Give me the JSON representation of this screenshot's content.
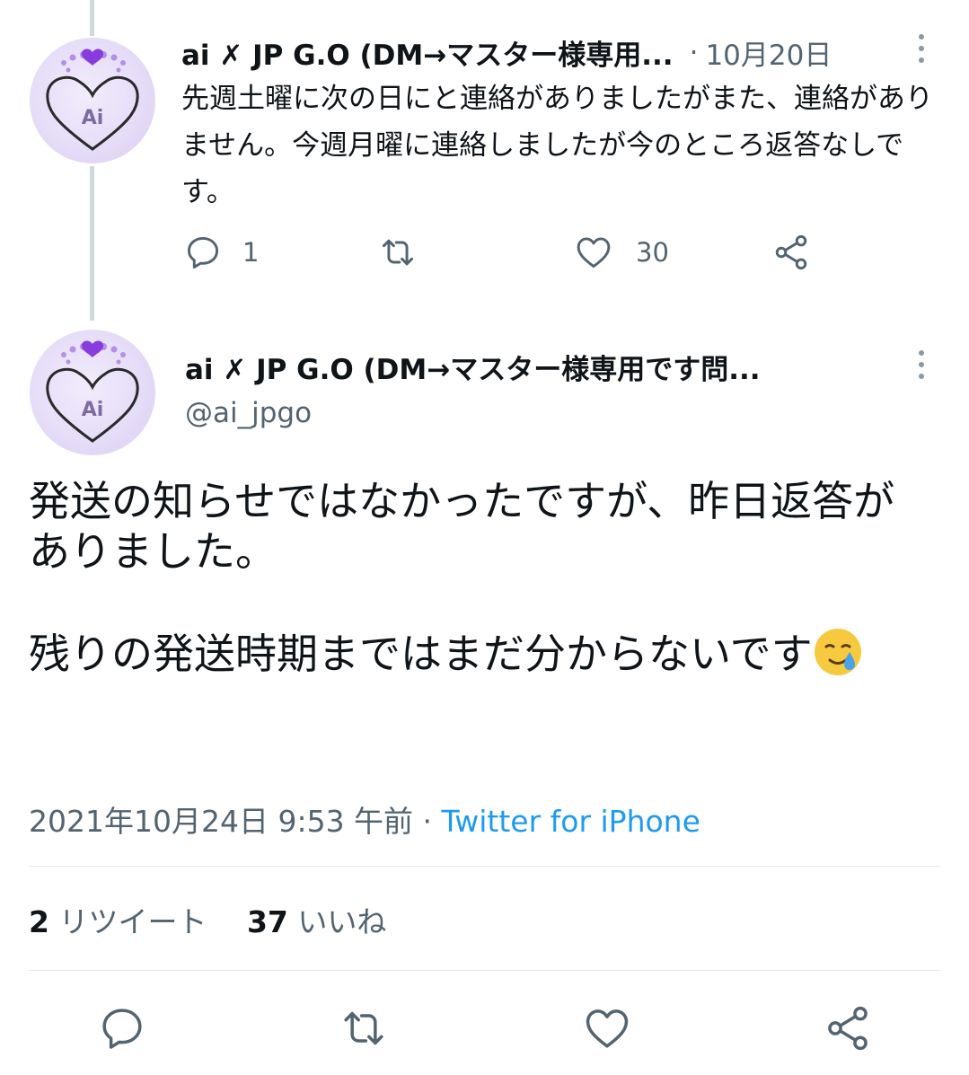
{
  "reply_tweet": {
    "display_name": "ai ✗ JP G.O (DM→マスター様専用...",
    "separator": "·",
    "date": "10月20日",
    "text": "先週土曜に次の日にと連絡がありましたがまた、連絡がありません。今週月曜に連絡しましたが今のところ返答なしです。",
    "reply_count": "1",
    "like_count": "30",
    "avatar_label": "Ai"
  },
  "main_tweet": {
    "display_name": "ai ✗ JP G.O (DM→マスター様専用です問...",
    "handle": "@ai_jpgo",
    "avatar_label": "Ai",
    "text_line1": "発送の知らせではなかったですが、昨日返答がありました。",
    "text_line2": "残りの発送時期まではまだ分からないです",
    "emoji": "crying-face-emoji",
    "timestamp": "2021年10月24日 9:53 午前",
    "meta_separator": " · ",
    "source": "Twitter for iPhone",
    "retweets_count": "2",
    "retweets_label": "リツイート",
    "likes_count": "37",
    "likes_label": "いいね"
  },
  "colors": {
    "text": "#0f1419",
    "secondary": "#536471",
    "link": "#1d9bf0",
    "divider": "#e1e8ed",
    "thread_line": "#cfd9de",
    "avatar_bg": "#e6ddf8"
  }
}
